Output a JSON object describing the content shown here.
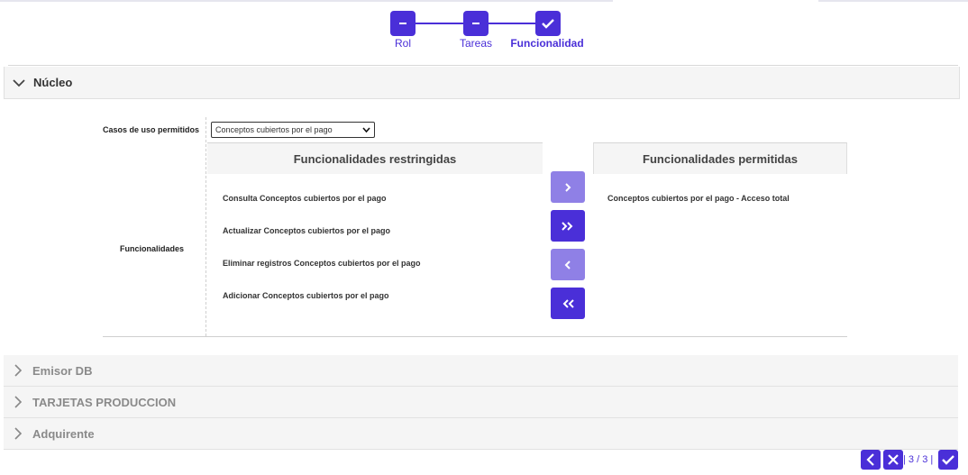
{
  "stepper": {
    "steps": [
      {
        "label": "Rol",
        "icon": "minus-icon",
        "state": "done"
      },
      {
        "label": "Tareas",
        "icon": "minus-icon",
        "state": "done"
      },
      {
        "label": "Funcionalidad",
        "icon": "check-icon",
        "state": "active"
      }
    ]
  },
  "sections": {
    "open": {
      "title": "Núcleo",
      "icon": "chevron-down-icon"
    },
    "closed": [
      {
        "title": "Emisor DB",
        "icon": "chevron-right-icon"
      },
      {
        "title": "TARJETAS PRODUCCION",
        "icon": "chevron-right-icon"
      },
      {
        "title": "Adquirente",
        "icon": "chevron-right-icon"
      }
    ]
  },
  "form": {
    "case_label": "Casos de uso permitidos",
    "case_selected": "Conceptos cubiertos por el pago",
    "func_label": "Funcionalidades"
  },
  "restricted": {
    "header": "Funcionalidades restringidas",
    "items": [
      "Consulta Conceptos cubiertos por el pago",
      "Actualizar Conceptos cubiertos por el pago",
      "Eliminar registros Conceptos cubiertos por el pago",
      "Adicionar Conceptos cubiertos por el pago"
    ]
  },
  "permitted": {
    "header": "Funcionalidades permitidas",
    "items": [
      "Conceptos cubiertos por el pago - Acceso total"
    ]
  },
  "transfer_buttons": [
    {
      "icon": "chevron-right-icon",
      "state": "disabled"
    },
    {
      "icon": "double-chevron-right-icon",
      "state": "enabled"
    },
    {
      "icon": "chevron-left-icon",
      "state": "disabled"
    },
    {
      "icon": "double-chevron-left-icon",
      "state": "enabled"
    }
  ],
  "pager": {
    "text": "| 3 / 3 |"
  },
  "colors": {
    "accent": "#4a2fd8",
    "accent_disabled": "#8f80e6",
    "section_bg": "#f5f5f5"
  }
}
